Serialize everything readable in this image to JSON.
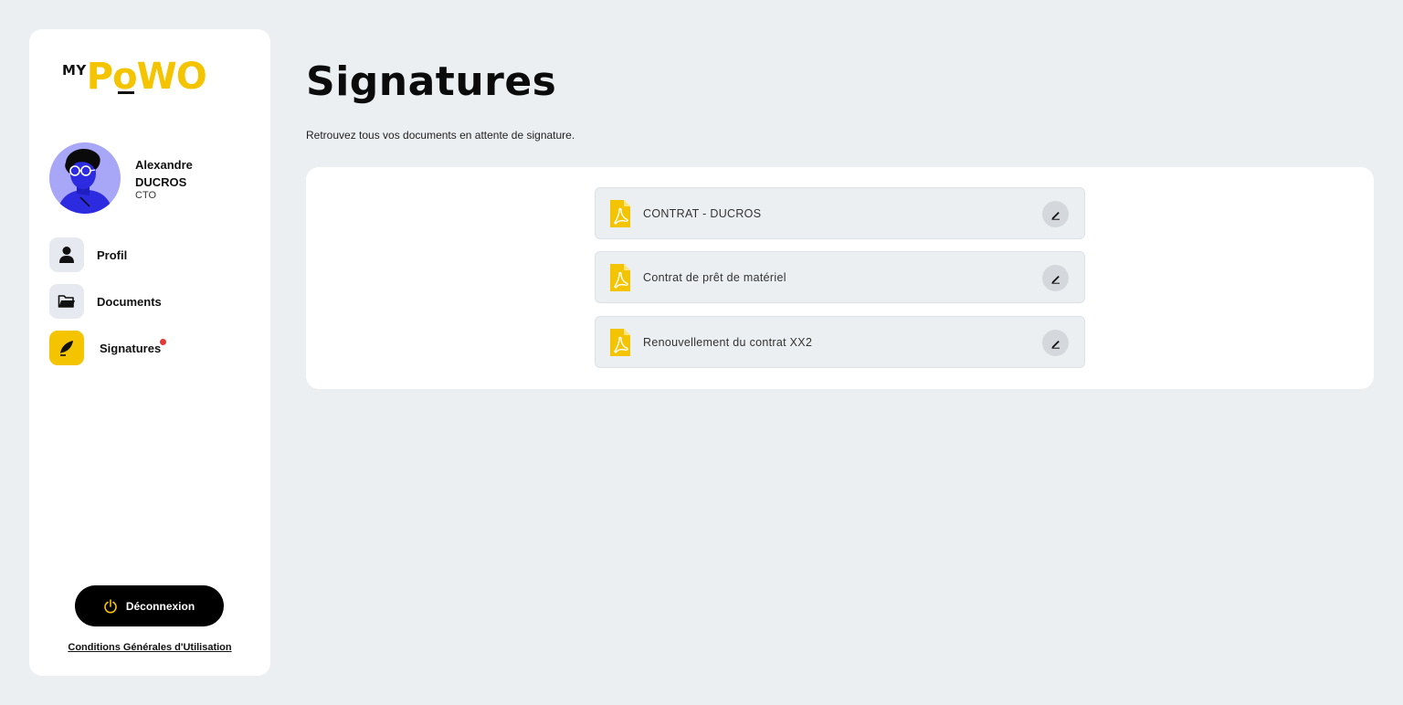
{
  "logo": {
    "my": "MY",
    "brand": "PoWO"
  },
  "user": {
    "first_name": "Alexandre",
    "last_name": "DUCROS",
    "role": "CTO"
  },
  "nav": {
    "items": [
      {
        "label": "Profil",
        "icon": "user-icon"
      },
      {
        "label": "Documents",
        "icon": "folder-icon"
      },
      {
        "label": "Signatures",
        "icon": "feather-pen-icon",
        "active": true,
        "has_notification": true
      }
    ]
  },
  "logout": {
    "label": "Déconnexion",
    "icon": "power-icon"
  },
  "footer": {
    "cgu_link": "Conditions Générales d'Utilisation"
  },
  "page": {
    "title": "Signatures",
    "subtitle": "Retrouvez tous vos documents en attente de signature."
  },
  "documents": [
    {
      "name": "CONTRAT - DUCROS",
      "icon": "pdf-icon",
      "action_icon": "pen-icon"
    },
    {
      "name": "Contrat de prêt de matériel",
      "icon": "pdf-icon",
      "action_icon": "pen-icon"
    },
    {
      "name": "Renouvellement du contrat XX2",
      "icon": "pdf-icon",
      "action_icon": "pen-icon"
    }
  ],
  "colors": {
    "accent": "#f5c400",
    "background": "#eceff2",
    "notification": "#e53935",
    "avatar_bg": "#a8a6f6"
  }
}
